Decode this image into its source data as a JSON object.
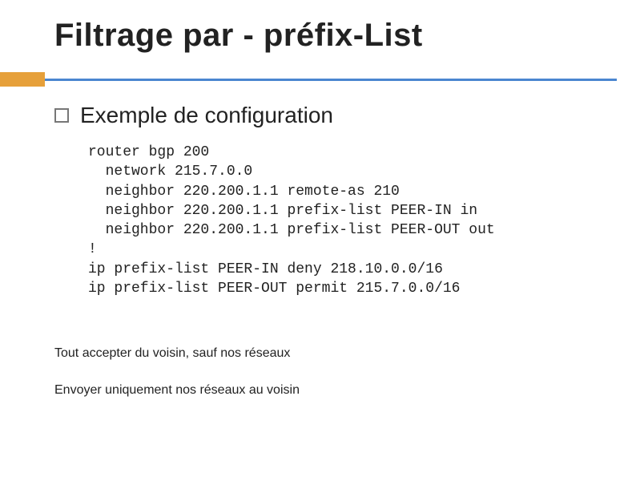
{
  "title": "Filtrage par  -  préfix-List",
  "section": {
    "heading": "Exemple de configuration"
  },
  "config": {
    "lines": [
      "router bgp 200",
      "  network 215.7.0.0",
      "  neighbor 220.200.1.1 remote-as 210",
      "  neighbor 220.200.1.1 prefix-list PEER-IN in",
      "  neighbor 220.200.1.1 prefix-list PEER-OUT out",
      "!",
      "ip prefix-list PEER-IN deny 218.10.0.0/16",
      "ip prefix-list PEER-OUT permit 215.7.0.0/16"
    ]
  },
  "notes": {
    "accept": "Tout accepter du voisin, sauf nos réseaux",
    "send": "Envoyer uniquement nos réseaux au voisin"
  },
  "colors": {
    "accent": "#e6a03a",
    "rule": "#4a86d0"
  }
}
